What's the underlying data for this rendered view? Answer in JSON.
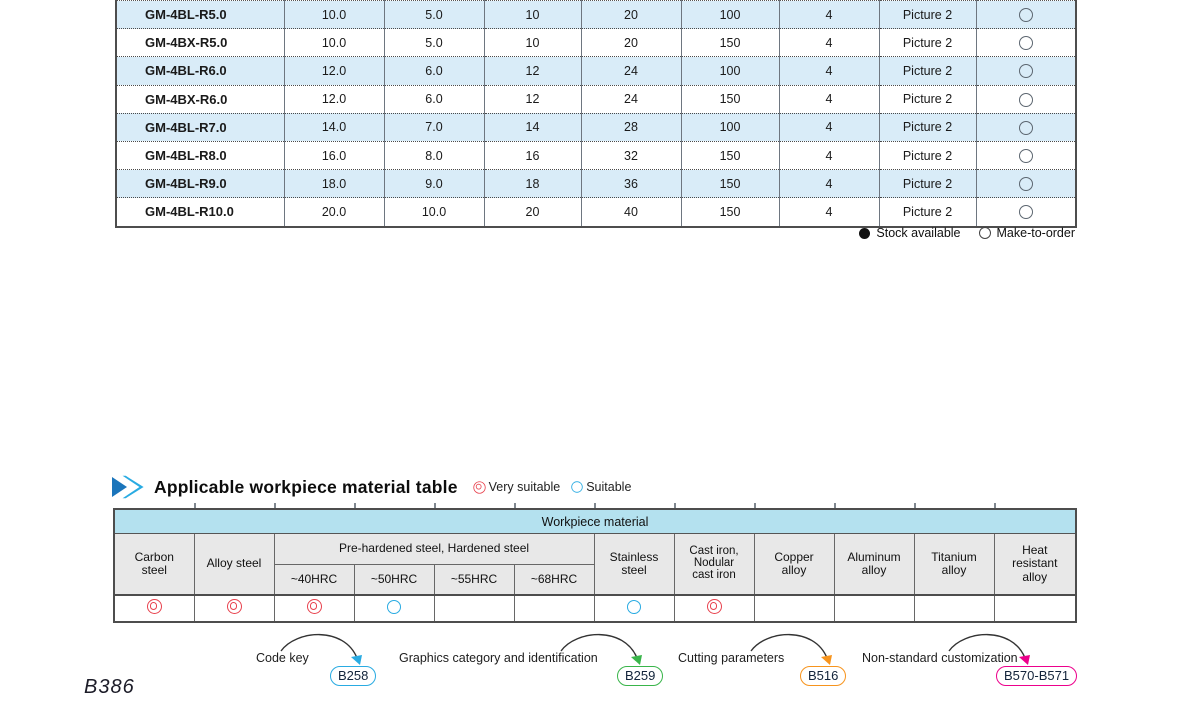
{
  "product_table": {
    "rows": [
      {
        "model": "GM-4BL-R5.0",
        "values": [
          "10.0",
          "5.0",
          "10",
          "20",
          "100",
          "4"
        ],
        "picture": "Picture 2",
        "stock": "make-to-order"
      },
      {
        "model": "GM-4BX-R5.0",
        "values": [
          "10.0",
          "5.0",
          "10",
          "20",
          "150",
          "4"
        ],
        "picture": "Picture 2",
        "stock": "make-to-order"
      },
      {
        "model": "GM-4BL-R6.0",
        "values": [
          "12.0",
          "6.0",
          "12",
          "24",
          "100",
          "4"
        ],
        "picture": "Picture 2",
        "stock": "make-to-order"
      },
      {
        "model": "GM-4BX-R6.0",
        "values": [
          "12.0",
          "6.0",
          "12",
          "24",
          "150",
          "4"
        ],
        "picture": "Picture 2",
        "stock": "make-to-order"
      },
      {
        "model": "GM-4BL-R7.0",
        "values": [
          "14.0",
          "7.0",
          "14",
          "28",
          "100",
          "4"
        ],
        "picture": "Picture 2",
        "stock": "make-to-order"
      },
      {
        "model": "GM-4BL-R8.0",
        "values": [
          "16.0",
          "8.0",
          "16",
          "32",
          "150",
          "4"
        ],
        "picture": "Picture 2",
        "stock": "make-to-order"
      },
      {
        "model": "GM-4BL-R9.0",
        "values": [
          "18.0",
          "9.0",
          "18",
          "36",
          "150",
          "4"
        ],
        "picture": "Picture 2",
        "stock": "make-to-order"
      },
      {
        "model": "GM-4BL-R10.0",
        "values": [
          "20.0",
          "10.0",
          "20",
          "40",
          "150",
          "4"
        ],
        "picture": "Picture 2",
        "stock": "make-to-order"
      }
    ]
  },
  "stock_legend": {
    "available_label": "Stock available",
    "make_to_order_label": "Make-to-order"
  },
  "material_section": {
    "title": "Applicable workpiece material table",
    "very_suitable_label": "Very suitable",
    "suitable_label": "Suitable",
    "table": {
      "caption": "Workpiece material",
      "group_header": "Pre-hardened steel,  Hardened steel",
      "columns": [
        "Carbon\nsteel",
        "Alloy steel",
        "~40HRC",
        "~50HRC",
        "~55HRC",
        "~68HRC",
        "Stainless\nsteel",
        "Cast iron,\nNodular\ncast iron",
        "Copper\nalloy",
        "Aluminum\nalloy",
        "Titanium\nalloy",
        "Heat\nresistant\nalloy"
      ],
      "ratings": [
        "very",
        "very",
        "very",
        "suitable",
        "",
        "",
        "suitable",
        "very",
        "",
        "",
        "",
        ""
      ]
    }
  },
  "footer": {
    "annotations": [
      {
        "label": "Code key",
        "badge": "B258",
        "color": "#29abe2"
      },
      {
        "label": "Graphics category and identification",
        "badge": "B259",
        "color": "#39b54a"
      },
      {
        "label": "Cutting parameters",
        "badge": "B516",
        "color": "#f7941d"
      },
      {
        "label": "Non-standard customization",
        "badge": "B570-B571",
        "color": "#ec008c"
      }
    ],
    "page_number": "B386"
  },
  "colors": {
    "row_alt": "#d9ecf8",
    "band": "#b4e1ef",
    "header_gray": "#e8e8e8",
    "very_suitable": "#e8414d",
    "suitable": "#29abe2",
    "icon_dark_blue": "#1b75bb",
    "icon_light_blue": "#29abe2"
  }
}
